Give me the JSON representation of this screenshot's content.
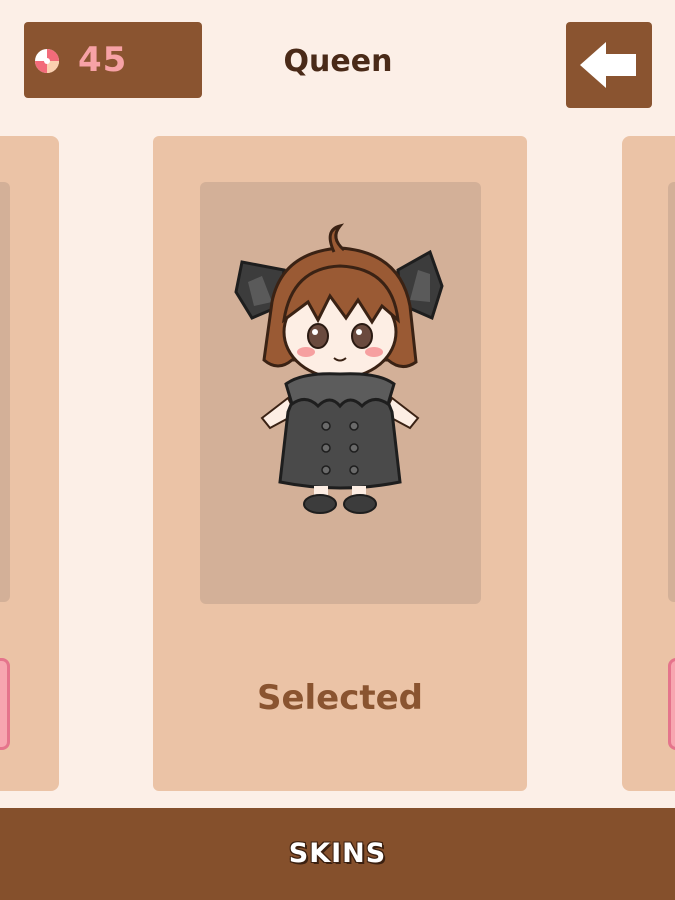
{
  "header": {
    "currency": {
      "icon": "candy-icon",
      "value": "45"
    },
    "title": "Queen",
    "back_icon": "back-arrow-icon"
  },
  "carousel": {
    "current": {
      "status": "Selected"
    }
  },
  "bottom_bar": {
    "label": "SKINS"
  },
  "colors": {
    "background": "#fcefe7",
    "brown": "#8a5430",
    "card": "#ebc3a6",
    "preview": "#d3b098",
    "currency_text": "#f7a2a6",
    "side_button": "#f7a6b0"
  }
}
